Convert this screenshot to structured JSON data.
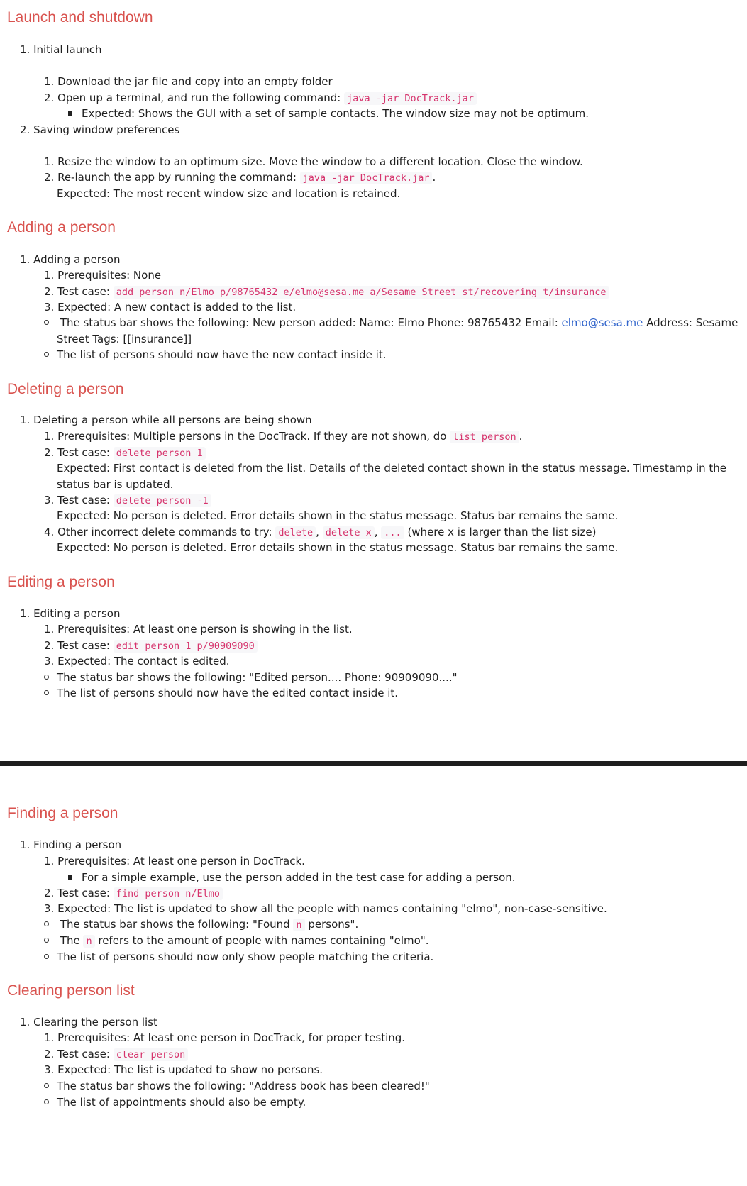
{
  "sections": {
    "launch": {
      "title": "Launch and shutdown",
      "i1": "1. Initial launch",
      "i1_1": "1. Download the jar file and copy into an empty folder",
      "i1_2_pre": "2. Open up a terminal, and run the following command: ",
      "i1_2_code": "java -jar DocTrack.jar",
      "i1_2_b": "Expected: Shows the GUI with a set of sample contacts. The window size may not be optimum.",
      "i2": "2. Saving window preferences",
      "i2_1": "1. Resize the window to an optimum size. Move the window to a different location. Close the window.",
      "i2_2_pre": "2. Re-launch the app by running the command: ",
      "i2_2_code": "java -jar DocTrack.jar",
      "i2_2_post": ".",
      "i2_2_exp": "Expected: The most recent window size and location is retained."
    },
    "adding": {
      "title": "Adding a person",
      "i1": "1. Adding a person",
      "s1": "1. Prerequisites: None",
      "s2_pre": "2. Test case: ",
      "s2_code": "add person n/Elmo p/98765432 e/elmo@sesa.me a/Sesame Street st/recovering t/insurance",
      "s3": "3. Expected: A new contact is added to the list.",
      "b1_pre": "The status bar shows the following: New person added: Name: Elmo Phone: 98765432 Email: ",
      "b1_link": "elmo@sesa.me",
      "b1_post": " Address: Sesame",
      "b1_cont": "Street Tags: [[insurance]]",
      "b2": "The list of persons should now have the new contact inside it."
    },
    "deleting": {
      "title": "Deleting a person",
      "i1": "1. Deleting a person while all persons are being shown",
      "s1_pre": "1. Prerequisites: Multiple persons in the DocTrack. If they are not shown, do ",
      "s1_code": "list person",
      "s1_post": ".",
      "s2_pre": "2. Test case: ",
      "s2_code": "delete person 1",
      "s2_exp": "Expected: First contact is deleted from the list. Details of the deleted contact shown in the status message. Timestamp in the",
      "s2_exp2": "status bar is updated.",
      "s3_pre": "3. Test case: ",
      "s3_code": "delete person -1",
      "s3_exp": "Expected: No person is deleted. Error details shown in the status message. Status bar remains the same.",
      "s4_pre": "4. Other incorrect delete commands to try: ",
      "s4_code1": "delete",
      "s4_sep1": ", ",
      "s4_code2": "delete x",
      "s4_sep2": ", ",
      "s4_code3": "...",
      "s4_post": " (where x is larger than the list size)",
      "s4_exp": "Expected: No person is deleted. Error details shown in the status message. Status bar remains the same."
    },
    "editing": {
      "title": "Editing a person",
      "i1": "1. Editing a person",
      "s1": "1. Prerequisites: At least one person is showing in the list.",
      "s2_pre": "2. Test case: ",
      "s2_code": "edit person 1 p/90909090",
      "s3": "3. Expected: The contact is edited.",
      "b1": "The status bar shows the following: \"Edited person.... Phone: 90909090....\"",
      "b2": "The list of persons should now have the edited contact inside it."
    },
    "finding": {
      "title": "Finding a person",
      "i1": "1. Finding a person",
      "s1": "1. Prerequisites: At least one person in DocTrack.",
      "s1_b": "For a simple example, use the person added in the test case for adding a person.",
      "s2_pre": "2. Test case: ",
      "s2_code": "find person n/Elmo",
      "s3": "3. Expected: The list is updated to show all the people with names containing \"elmo\", non-case-sensitive.",
      "b1_pre": "The status bar shows the following: \"Found ",
      "b1_code": "n",
      "b1_post": " persons\".",
      "b2_pre": "The ",
      "b2_code": "n",
      "b2_post": " refers to the amount of people with names containing \"elmo\".",
      "b3": "The list of persons should now only show people matching the criteria."
    },
    "clearing": {
      "title": "Clearing person list",
      "i1": "1. Clearing the person list",
      "s1": "1. Prerequisites: At least one person in DocTrack, for proper testing.",
      "s2_pre": "2. Test case: ",
      "s2_code": "clear person",
      "s3": "3. Expected: The list is updated to show no persons.",
      "b1": "The status bar shows the following: \"Address book has been cleared!\"",
      "b2": "The list of appointments should also be empty."
    }
  }
}
